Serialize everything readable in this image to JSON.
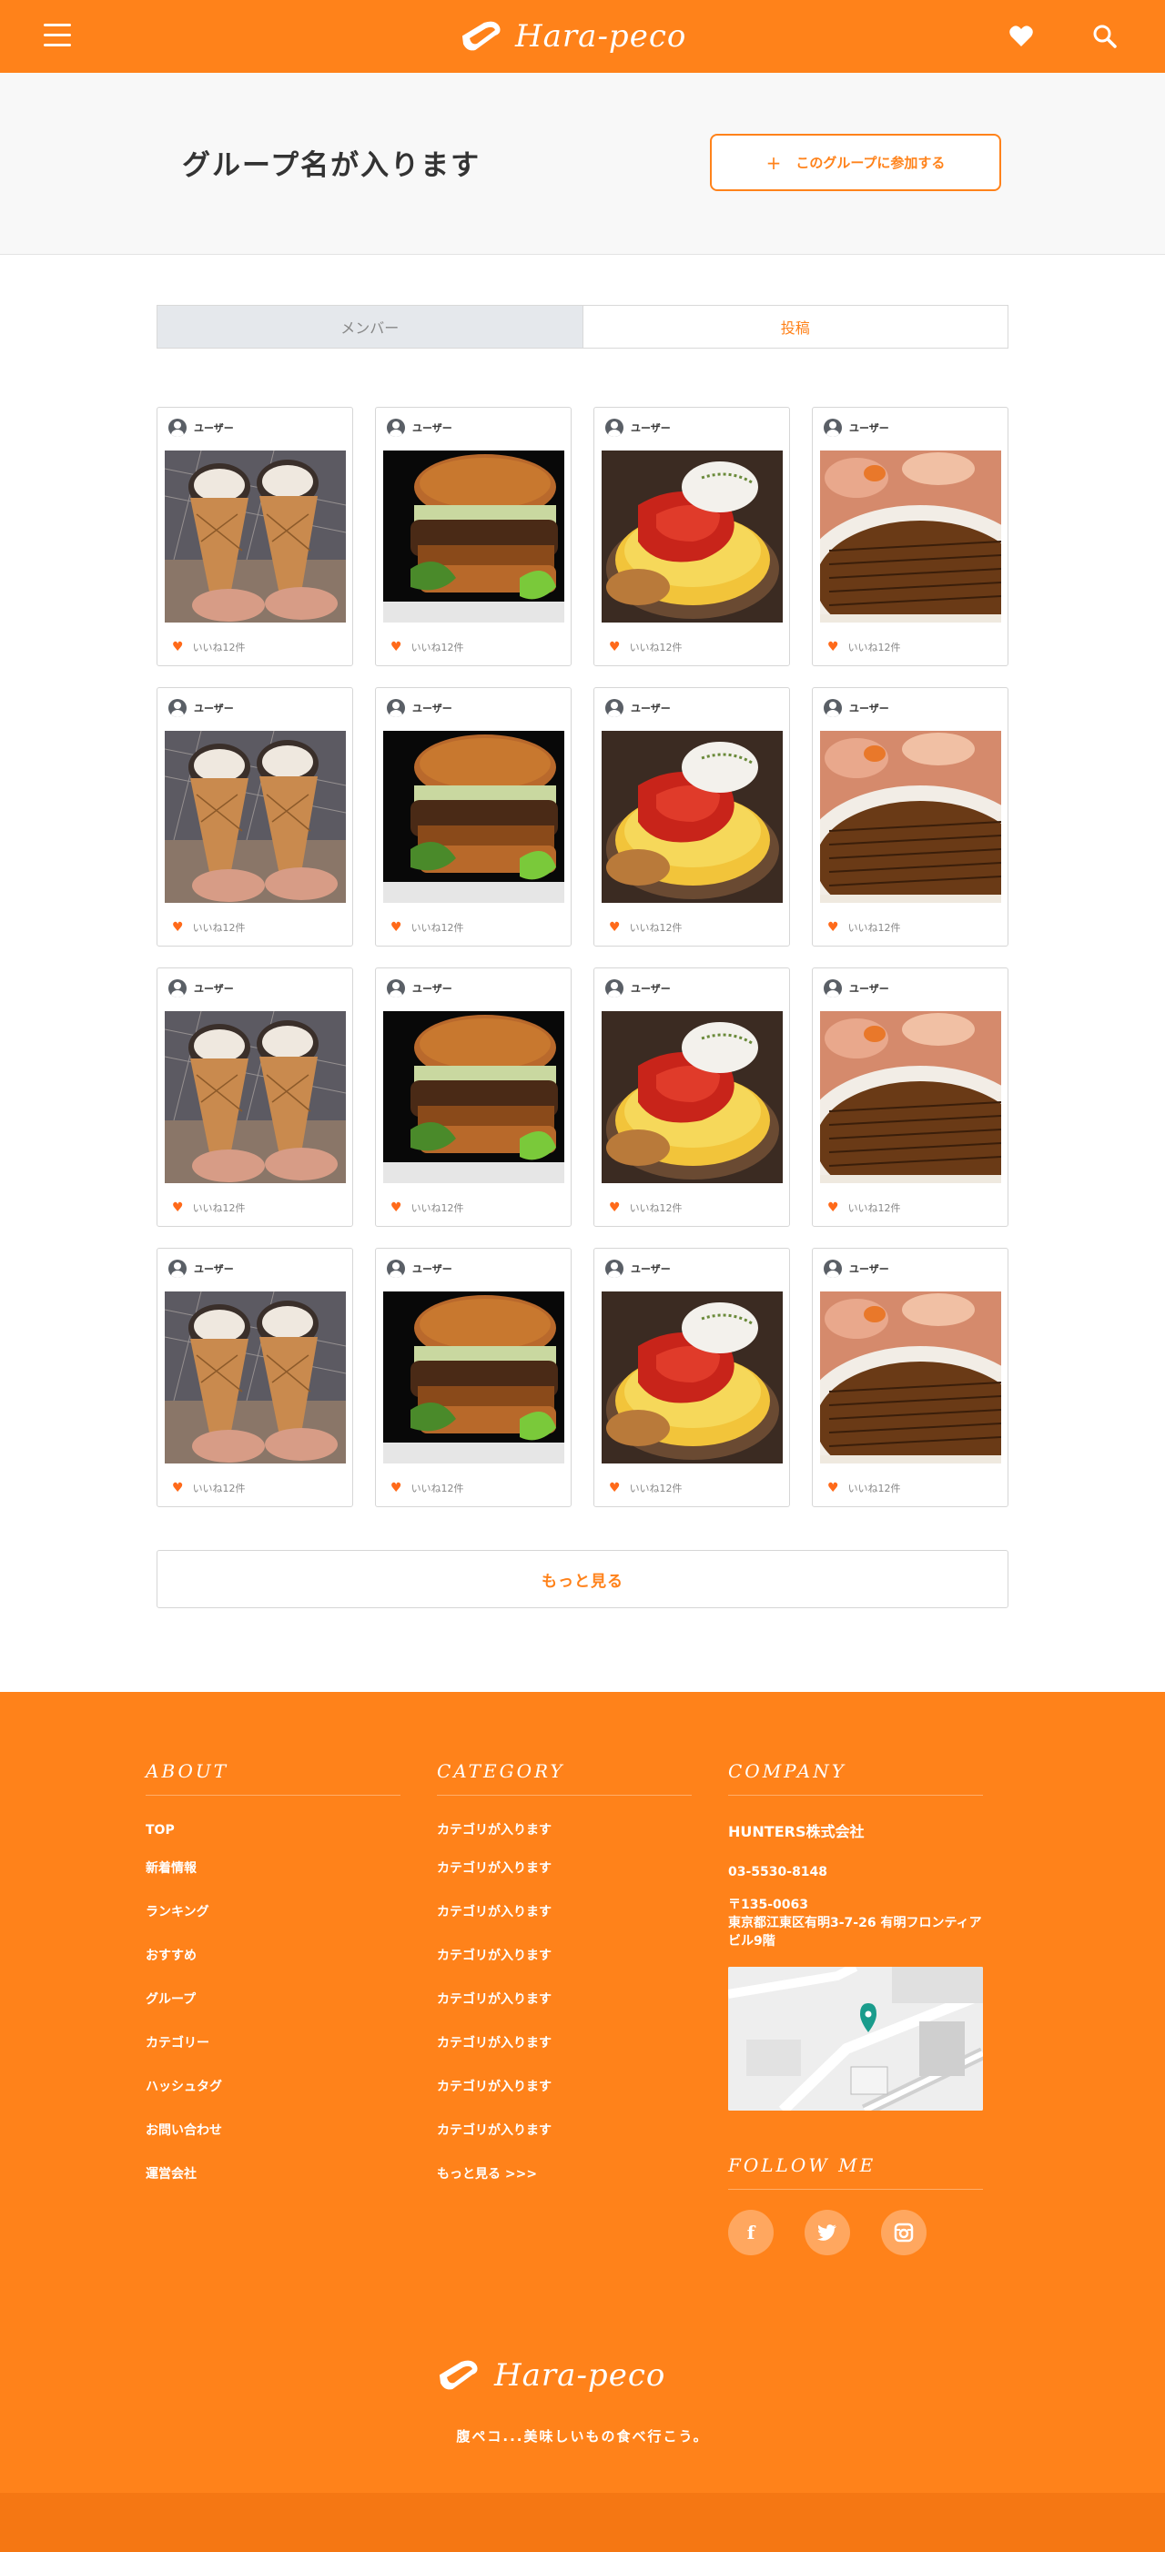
{
  "header": {
    "logo_text": "Hara-peco",
    "menu_icon": "hamburger-icon",
    "favorite_icon": "heart-icon",
    "search_icon": "search-icon"
  },
  "group": {
    "title": "グループ名が入ります",
    "join_label": "このグループに参加する",
    "join_icon": "+"
  },
  "tabs": [
    {
      "label": "メンバー",
      "active": false
    },
    {
      "label": "投稿",
      "active": true
    }
  ],
  "posts": [
    {
      "user": "ユーザー",
      "likes": "いいね12件",
      "photo": "ice-cream"
    },
    {
      "user": "ユーザー",
      "likes": "いいね12件",
      "photo": "burger"
    },
    {
      "user": "ユーザー",
      "likes": "いいね12件",
      "photo": "omurice"
    },
    {
      "user": "ユーザー",
      "likes": "いいね12件",
      "photo": "unagi"
    },
    {
      "user": "ユーザー",
      "likes": "いいね12件",
      "photo": "ice-cream"
    },
    {
      "user": "ユーザー",
      "likes": "いいね12件",
      "photo": "burger"
    },
    {
      "user": "ユーザー",
      "likes": "いいね12件",
      "photo": "omurice"
    },
    {
      "user": "ユーザー",
      "likes": "いいね12件",
      "photo": "unagi"
    },
    {
      "user": "ユーザー",
      "likes": "いいね12件",
      "photo": "ice-cream"
    },
    {
      "user": "ユーザー",
      "likes": "いいね12件",
      "photo": "burger"
    },
    {
      "user": "ユーザー",
      "likes": "いいね12件",
      "photo": "omurice"
    },
    {
      "user": "ユーザー",
      "likes": "いいね12件",
      "photo": "unagi"
    },
    {
      "user": "ユーザー",
      "likes": "いいね12件",
      "photo": "ice-cream"
    },
    {
      "user": "ユーザー",
      "likes": "いいね12件",
      "photo": "burger"
    },
    {
      "user": "ユーザー",
      "likes": "いいね12件",
      "photo": "omurice"
    },
    {
      "user": "ユーザー",
      "likes": "いいね12件",
      "photo": "unagi"
    }
  ],
  "more_label": "もっと見る",
  "footer": {
    "about": {
      "heading": "ABOUT",
      "links": [
        "TOP",
        "新着情報",
        "ランキング",
        "おすすめ",
        "グループ",
        "カテゴリー",
        "ハッシュタグ",
        "お問い合わせ",
        "運営会社"
      ]
    },
    "category": {
      "heading": "CATEGORY",
      "links": [
        "カテゴリが入ります",
        "カテゴリが入ります",
        "カテゴリが入ります",
        "カテゴリが入ります",
        "カテゴリが入ります",
        "カテゴリが入ります",
        "カテゴリが入ります",
        "カテゴリが入ります"
      ],
      "more": "もっと見る >>>"
    },
    "company": {
      "heading": "COMPANY",
      "name": "HUNTERS株式会社",
      "tel": "03-5530-8148",
      "zip": "〒135-0063",
      "address": "東京都江東区有明3-7-26 有明フロンティアビル9階"
    },
    "follow": {
      "heading": "FOLLOW ME",
      "socials": [
        {
          "name": "facebook",
          "glyph": "f"
        },
        {
          "name": "twitter",
          "glyph": "t"
        },
        {
          "name": "instagram",
          "glyph": "◎"
        }
      ]
    },
    "logo_text": "Hara-peco",
    "tagline": "腹ペコ...美味しいもの食べ行こう。"
  },
  "colors": {
    "brand": "#ff821a",
    "brand_dark": "#f57713",
    "map_pin": "#1a9c8c"
  }
}
